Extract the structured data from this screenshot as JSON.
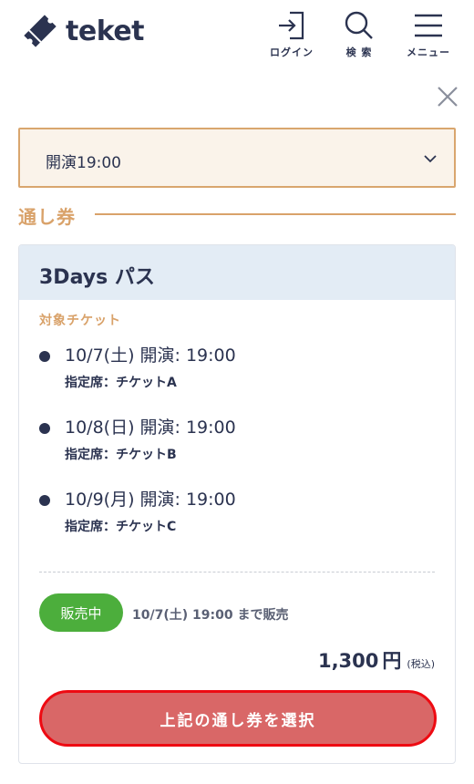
{
  "header": {
    "logo_text": "teket",
    "nav": [
      {
        "label": "ログイン",
        "icon": "login-icon"
      },
      {
        "label": "検 索",
        "icon": "search-icon"
      },
      {
        "label": "メニュー",
        "icon": "menu-icon"
      }
    ]
  },
  "performance_select": {
    "value": "開演19:00"
  },
  "section": {
    "title": "通し券"
  },
  "pass": {
    "title": "3Days パス",
    "target_label": "対象チケット",
    "tickets": [
      {
        "date": "10/7(土) 開演: 19:00",
        "seat": "指定席：チケットA"
      },
      {
        "date": "10/8(日) 開演: 19:00",
        "seat": "指定席：チケットB"
      },
      {
        "date": "10/9(月) 開演: 19:00",
        "seat": "指定席：チケットC"
      }
    ],
    "status_badge": "販売中",
    "sale_until": "10/7(土) 19:00 まで販売",
    "price": "1,300",
    "price_unit": "円",
    "price_tax": "(税込)",
    "select_button": "上記の通し券を選択"
  },
  "colors": {
    "navy": "#2b3350",
    "accent_gold": "#d9a26a",
    "select_bg": "#faf3ea",
    "card_head": "#e3ecf5",
    "sale_green": "#4cae3c",
    "button_red": "#d96767",
    "highlight_red": "#ee0a12"
  }
}
